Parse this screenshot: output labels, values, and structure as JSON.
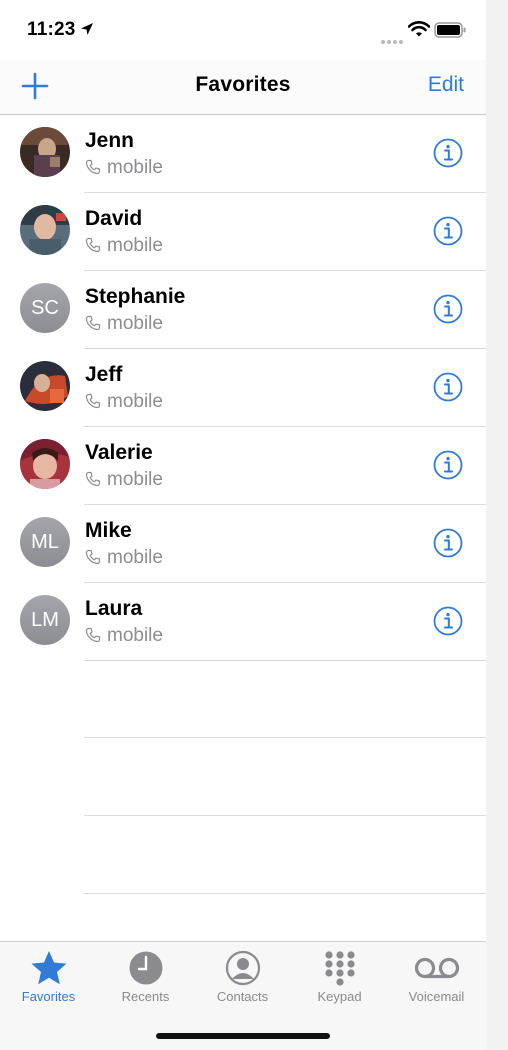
{
  "status_bar": {
    "time": "11:23"
  },
  "nav": {
    "title": "Favorites",
    "edit_label": "Edit"
  },
  "favorites": [
    {
      "name": "Jenn",
      "label": "mobile",
      "avatar": "photo"
    },
    {
      "name": "David",
      "label": "mobile",
      "avatar": "photo"
    },
    {
      "name": "Stephanie",
      "label": "mobile",
      "initials": "SC"
    },
    {
      "name": "Jeff",
      "label": "mobile",
      "avatar": "photo"
    },
    {
      "name": "Valerie",
      "label": "mobile",
      "avatar": "photo"
    },
    {
      "name": "Mike",
      "label": "mobile",
      "initials": "ML"
    },
    {
      "name": "Laura",
      "label": "mobile",
      "initials": "LM"
    }
  ],
  "tabs": [
    {
      "label": "Favorites",
      "icon": "star-icon",
      "active": true
    },
    {
      "label": "Recents",
      "icon": "clock-icon",
      "active": false
    },
    {
      "label": "Contacts",
      "icon": "person-circle-icon",
      "active": false
    },
    {
      "label": "Keypad",
      "icon": "keypad-icon",
      "active": false
    },
    {
      "label": "Voicemail",
      "icon": "voicemail-icon",
      "active": false
    }
  ],
  "colors": {
    "accent": "#2f7bd6",
    "secondary_text": "#8d8d92",
    "initials_bg": "#9a9ba0"
  }
}
